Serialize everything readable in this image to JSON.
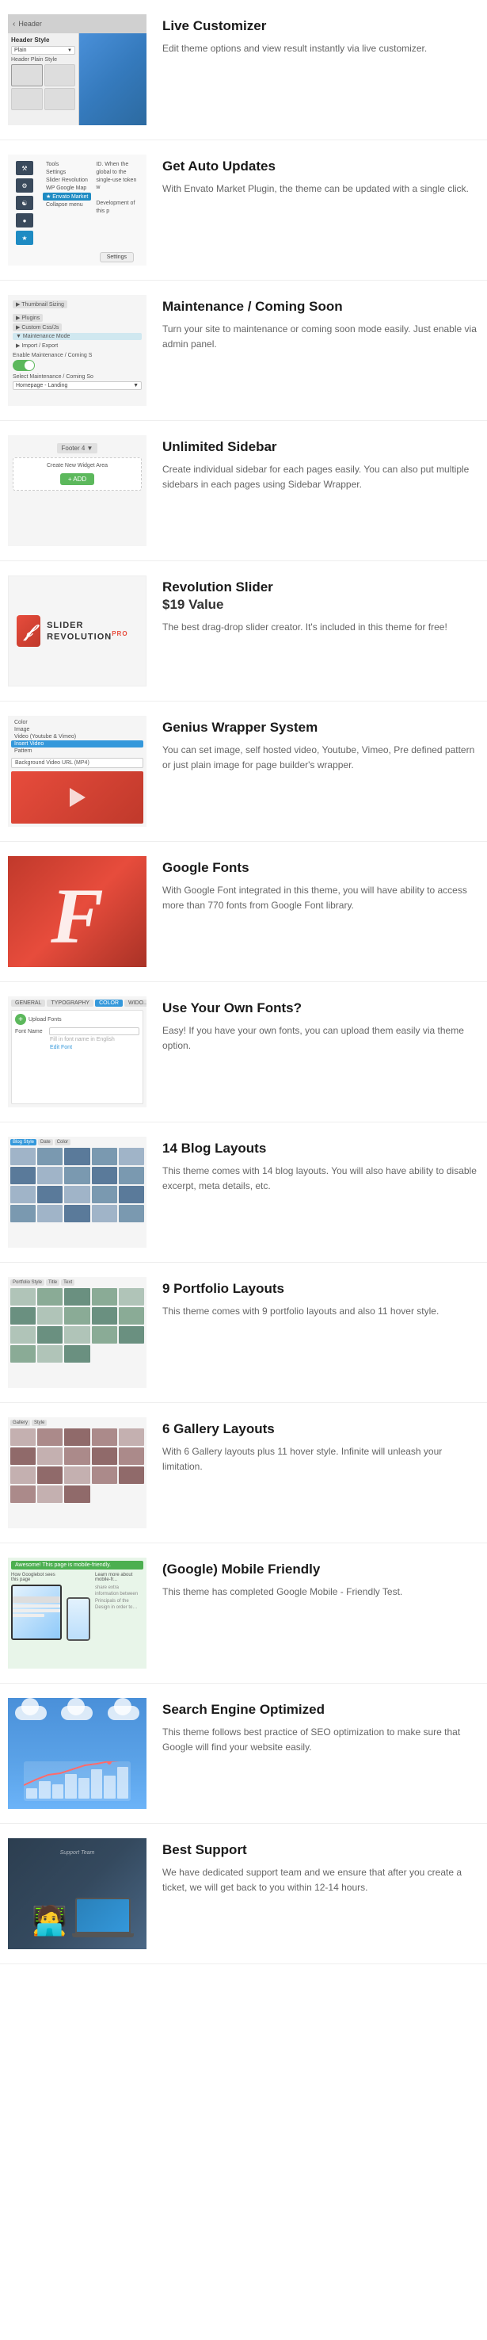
{
  "features": [
    {
      "id": "live-customizer",
      "title": "Live Customizer",
      "description": "Edit theme options and view result instantly via live customizer.",
      "header_label": "Header",
      "header_style_label": "Header Style",
      "header_plain_label": "Plain",
      "header_plain_style_label": "Header Plain Style"
    },
    {
      "id": "auto-updates",
      "title": "Get Auto Updates",
      "description": "With Envato Market Plugin, the theme can be updated with a single click.",
      "menu_items": [
        "Tools",
        "Settings",
        "Slider Revolution",
        "WP Google Map",
        "Envato Market",
        "Collapse menu"
      ],
      "settings_label": "Settings",
      "id_text": "ID. When the global to the single-use token w",
      "development_text": "Development of this p"
    },
    {
      "id": "maintenance",
      "title": "Maintenance / Coming Soon",
      "description": "Turn your site to maintenance or coming soon mode easily. Just enable via admin panel.",
      "enable_label": "Enable Maintenance / Coming S",
      "toggle_state": "on",
      "select_label": "Select Maintenance / Coming So",
      "select_value": "Homepage - Landing"
    },
    {
      "id": "unlimited-sidebar",
      "title": "Unlimited Sidebar",
      "description": "Create individual sidebar for each pages easily. You can also put multiple sidebars in each pages using Sidebar Wrapper.",
      "footer_label": "Footer 4",
      "create_label": "Create New Widget Area",
      "add_label": "+ ADD"
    },
    {
      "id": "revolution-slider",
      "title": "Revolution Slider",
      "subtitle": "$19 Value",
      "description": "The best drag-drop slider creator. It's included in this theme for free!",
      "logo_text": "SLIDER REVOLUTION",
      "logo_suffix": "PRO"
    },
    {
      "id": "genius-wrapper",
      "title": "Genius Wrapper System",
      "description": "You can set image, self hosted video, Youtube, Vimeo, Pre defined pattern or just plain image for page builder's wrapper.",
      "options": [
        "Color",
        "Image",
        "Video (Youtube & Vimeo)",
        "Insert Video",
        "Pattern"
      ],
      "selected_option": "Insert Video",
      "bg_video_label": "Background Video URL (MP4)"
    },
    {
      "id": "google-fonts",
      "title": "Google Fonts",
      "description": "With Google Font integrated in this theme, you will have ability to access more than 770 fonts from Google Font library.",
      "letter": "F"
    },
    {
      "id": "own-fonts",
      "title": "Use Your Own Fonts?",
      "description": "Easy! If you have your own fonts, you can upload them easily via theme option.",
      "tabs": [
        "GENERAL",
        "TYPOGRAPHY",
        "COLOR",
        "WIDO..."
      ],
      "upload_label": "Upload Fonts",
      "font_name_label": "Font Name",
      "font_name_placeholder": "Fill in font name in English",
      "edit_font_label": "Edit Font"
    },
    {
      "id": "blog-layouts",
      "title": "14 Blog Layouts",
      "description": "This theme comes with 14 blog layouts. You will also have ability to disable excerpt, meta details, etc.",
      "tabs": [
        "Blog Style",
        "Date",
        "Color"
      ]
    },
    {
      "id": "portfolio-layouts",
      "title": "9 Portfolio Layouts",
      "description": "This theme comes with 9 portfolio layouts and also 11 hover style.",
      "tabs": [
        "Portfolio Style",
        "Title",
        "Text"
      ]
    },
    {
      "id": "gallery-layouts",
      "title": "6 Gallery Layouts",
      "description": "With 6 Gallery layouts plus 11 hover style. Infinite will unleash your limitation.",
      "tabs": [
        "Gallery",
        "Style"
      ]
    },
    {
      "id": "mobile-friendly",
      "title": "(Google) Mobile Friendly",
      "description": "This theme has completed Google Mobile - Friendly Test.",
      "bar_text": "Awesome! This page is mobile-friendly.",
      "left_label": "How Googlebot sees this page",
      "right_label": "Learn more about mobile-fr..."
    },
    {
      "id": "seo",
      "title": "Search Engine Optimized",
      "description": "This theme follows best practice of SEO optimization to make sure that Google will find your website easily."
    },
    {
      "id": "support",
      "title": "Best Support",
      "description": "We have dedicated support team and we ensure that after you create a ticket, we will get back to you within 12-14 hours."
    }
  ]
}
